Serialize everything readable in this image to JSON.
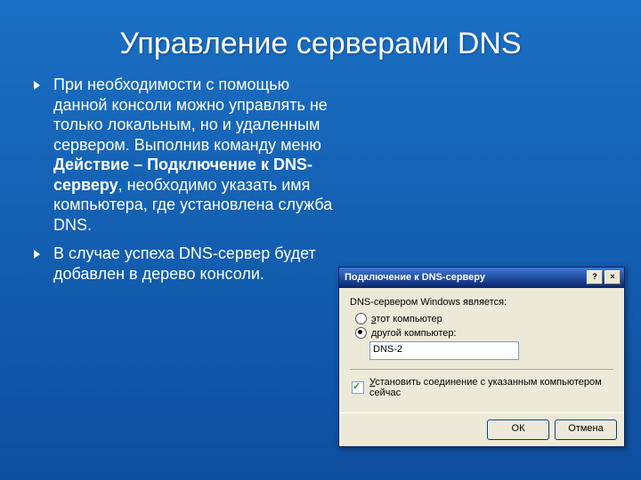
{
  "title": "Управление серверами DNS",
  "bullets": [
    {
      "pre": "При необходимости с помощью данной консоли можно управлять не только локальным, но и удаленным сервером. Выполнив команду меню ",
      "bold": "Действие – Подключение к DNS-серверу",
      "post": ", необходимо указать имя компьютера, где установлена служба DNS."
    },
    {
      "pre": "В случае успеха DNS-сервер будет добавлен в дерево консоли.",
      "bold": "",
      "post": ""
    }
  ],
  "dialog": {
    "title": "Подключение к DNS-серверу",
    "help_glyph": "?",
    "close_glyph": "×",
    "section": "DNS-сервером Windows является:",
    "radio1_u": "э",
    "radio1_rest": "тот компьютер",
    "radio2_u": "д",
    "radio2_rest": "ругой компьютер:",
    "input_value": "DNS-2",
    "check_u": "У",
    "check_rest": "становить соединение с указанным компьютером сейчас",
    "ok": "ОК",
    "cancel": "Отмена"
  }
}
